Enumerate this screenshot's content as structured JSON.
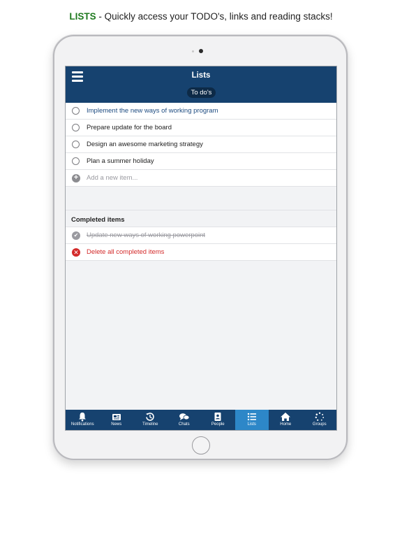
{
  "caption": {
    "highlight": "LISTS",
    "rest": " - Quickly access your TODO's, links and reading stacks!"
  },
  "header": {
    "title": "Lists",
    "tab_label": "To do's",
    "menu_icon": "hamburger-icon"
  },
  "todo_items": [
    {
      "label": "Implement the new ways of working program",
      "style": "link"
    },
    {
      "label": "Prepare update for the board",
      "style": "normal"
    },
    {
      "label": "Design an awesome marketing strategy",
      "style": "normal"
    },
    {
      "label": "Plan a summer holiday",
      "style": "normal"
    }
  ],
  "add_item": {
    "placeholder": "Add a new item..."
  },
  "completed": {
    "heading": "Completed items",
    "items": [
      {
        "label": "Update new ways of working powerpoint"
      }
    ],
    "delete_label": "Delete all completed items"
  },
  "tabbar": {
    "active": "Lists",
    "tabs": [
      {
        "label": "Notifications",
        "icon": "bell-icon"
      },
      {
        "label": "News",
        "icon": "newspaper-icon"
      },
      {
        "label": "Timeline",
        "icon": "history-icon"
      },
      {
        "label": "Chats",
        "icon": "chat-bubbles-icon"
      },
      {
        "label": "People",
        "icon": "contact-card-icon"
      },
      {
        "label": "Lists",
        "icon": "list-icon"
      },
      {
        "label": "Home",
        "icon": "home-icon"
      },
      {
        "label": "Groups",
        "icon": "dots-circle-icon"
      }
    ]
  },
  "colors": {
    "header_bg": "#16426f",
    "active_tab": "#2d87c8",
    "caption_accent": "#1f7a1f",
    "danger": "#d32a2a",
    "link": "#1d4b80"
  }
}
